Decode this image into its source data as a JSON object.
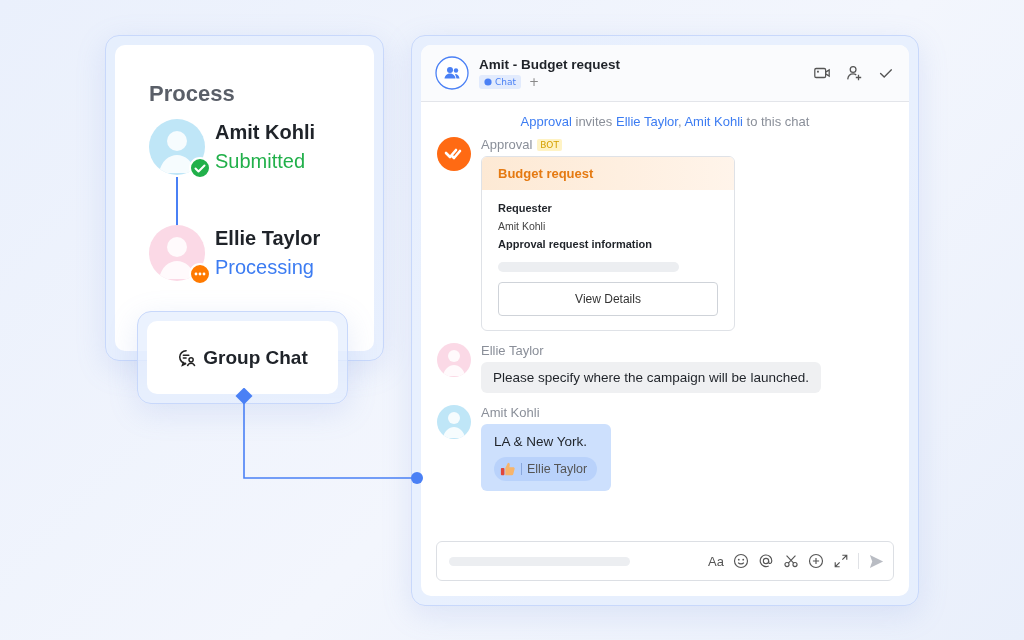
{
  "process": {
    "title": "Process",
    "steps": [
      {
        "name": "Amit Kohli",
        "status": "Submitted",
        "kind": "submitted",
        "color": "#bfe6f7"
      },
      {
        "name": "Ellie Taylor",
        "status": "Processing",
        "kind": "processing",
        "color": "#fbd9e6"
      }
    ]
  },
  "group_chat": {
    "label": "Group Chat"
  },
  "chat": {
    "title": "Amit - Budget request",
    "tag": "Chat",
    "add": "+",
    "notice": [
      {
        "text": "Approval",
        "kind": "link"
      },
      {
        "text": " invites ",
        "kind": "plain"
      },
      {
        "text": "Ellie Taylor",
        "kind": "link"
      },
      {
        "text": ", ",
        "kind": "plain"
      },
      {
        "text": "Amit Kohli",
        "kind": "link"
      },
      {
        "text": " to this chat",
        "kind": "plain"
      }
    ],
    "bot": {
      "sender": "Approval",
      "badge": "BOT",
      "card": {
        "title": "Budget request",
        "fields": [
          {
            "label": "Requester",
            "value": "Amit Kohli"
          },
          {
            "label": "Approval request information"
          }
        ],
        "button": "View Details"
      }
    },
    "messages": [
      {
        "sender": "Ellie Taylor",
        "text": "Please specify where the campaign will be launched.",
        "kind": "incoming",
        "color": "#fbd9e6"
      },
      {
        "sender": "Amit Kohli",
        "text": "LA & New York.",
        "kind": "highlighted",
        "color": "#bfe6f7",
        "reaction": {
          "name": "Ellie Taylor"
        }
      }
    ],
    "composer": {
      "format_label": "Aa"
    }
  }
}
